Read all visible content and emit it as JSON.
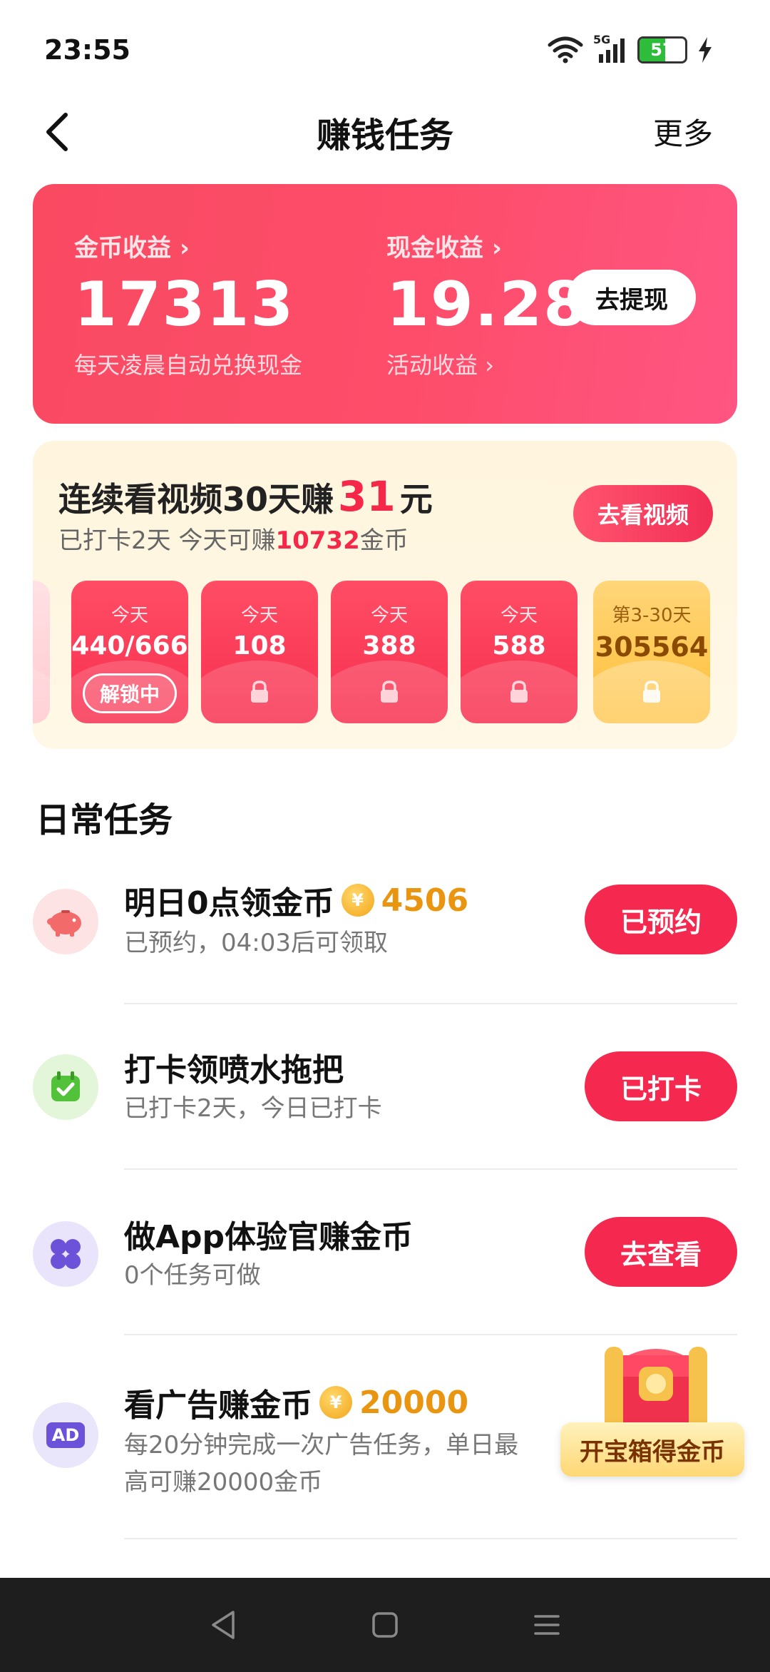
{
  "status_bar": {
    "time": "23:55",
    "network": "5G",
    "battery": "57",
    "battery_level": 0.57
  },
  "header": {
    "title": "赚钱任务",
    "more": "更多"
  },
  "earnings": {
    "coins": {
      "label": "金币收益",
      "value": "17313",
      "sub": "每天凌晨自动兑换现金"
    },
    "cash": {
      "label": "现金收益",
      "value": "19.28",
      "sub": "活动收益"
    },
    "withdraw_button": "去提现"
  },
  "streak": {
    "title_prefix": "连续看视频30天赚",
    "title_amount": "31",
    "title_suffix": "元",
    "sub_prefix": "已打卡2天 今天可赚",
    "sub_amount": "10732",
    "sub_suffix": "金币",
    "button": "去看视频",
    "days": [
      {
        "label": "今天",
        "value": "440/666",
        "status": "解锁中"
      },
      {
        "label": "今天",
        "value": "108"
      },
      {
        "label": "今天",
        "value": "388"
      },
      {
        "label": "今天",
        "value": "588"
      },
      {
        "label": "第3-30天",
        "value": "305564"
      }
    ]
  },
  "daily": {
    "title": "日常任务",
    "tasks": [
      {
        "title": "明日0点领金币",
        "coin": "¥",
        "amount": "4506",
        "desc": "已预约，04:03后可领取",
        "button": "已预约",
        "icon": "piggy-bank-icon"
      },
      {
        "title": "打卡领喷水拖把",
        "desc": "已打卡2天，今日已打卡",
        "button": "已打卡",
        "icon": "calendar-check-icon"
      },
      {
        "title": "做App体验官赚金币",
        "desc": "0个任务可做",
        "button": "去查看",
        "icon": "four-leaf-icon"
      },
      {
        "title": "看广告赚金币",
        "coin": "¥",
        "amount": "20000",
        "desc_line1": "每20分钟完成一次广告任务，单日最",
        "desc_line2": "高可赚20000金币",
        "icon_text": "AD",
        "icon": "ad-icon"
      }
    ]
  },
  "treasure": {
    "label": "开宝箱得金币"
  },
  "colors": {
    "accent": "#f5294f",
    "gold": "#e99510",
    "card_red": "#fd4d6a"
  }
}
